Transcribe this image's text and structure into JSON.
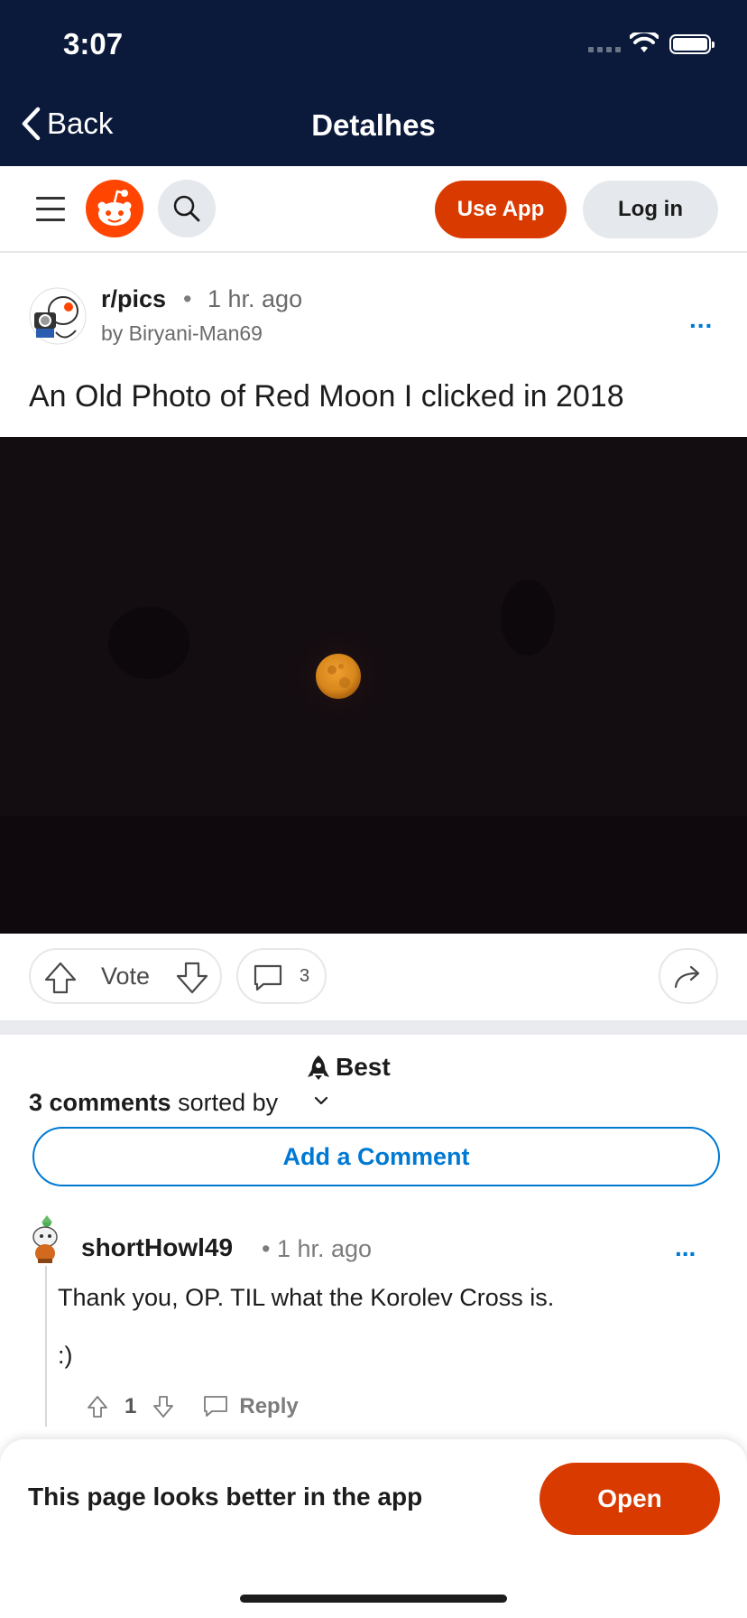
{
  "status_bar": {
    "time": "3:07"
  },
  "nav": {
    "back_label": "Back",
    "title": "Detalhes"
  },
  "header": {
    "use_app_label": "Use App",
    "login_label": "Log in"
  },
  "post": {
    "subreddit": "r/pics",
    "separator": "•",
    "time": "1 hr. ago",
    "author": "by Biryani-Man69",
    "more": "...",
    "title": "An Old Photo of Red Moon I clicked in 2018",
    "vote_label": "Vote",
    "comment_count": "3"
  },
  "comments_section": {
    "sort_value": "Best",
    "count_bold": "3 comments",
    "sorted_by": " sorted by",
    "add_comment_label": "Add a Comment"
  },
  "comments": [
    {
      "user": "shortHowl49",
      "time": "• 1 hr. ago",
      "more": "...",
      "line1": "Thank you, OP. TIL what the Korolev Cross is.",
      "line2": ":)",
      "score": "1",
      "reply_label": "Reply"
    }
  ],
  "app_sheet": {
    "text": "This page looks better in the app",
    "open_label": "Open"
  },
  "colors": {
    "nav_bg": "#0b1a3b",
    "brand": "#ff4500",
    "cta": "#d93a00",
    "link": "#0079d3"
  }
}
